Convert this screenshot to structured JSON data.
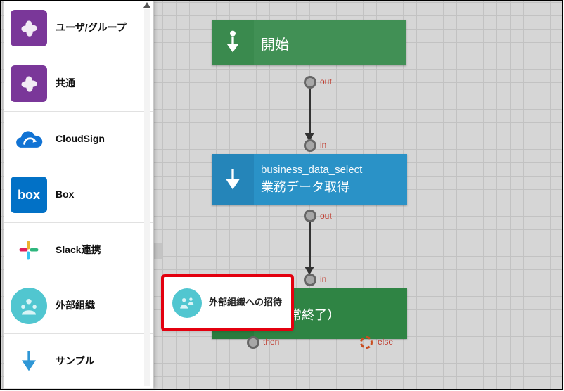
{
  "sidebar": {
    "items": [
      {
        "label": "ユーザ/グループ",
        "icon": "acrobat-icon"
      },
      {
        "label": "共通",
        "icon": "acrobat-icon"
      },
      {
        "label": "CloudSign",
        "icon": "cloudsign-icon"
      },
      {
        "label": "Box",
        "icon": "box-icon",
        "iconText": "box"
      },
      {
        "label": "Slack連携",
        "icon": "slack-icon"
      },
      {
        "label": "外部組織",
        "icon": "extorg-icon"
      },
      {
        "label": "サンプル",
        "icon": "sample-icon"
      }
    ]
  },
  "flow": {
    "start": {
      "title": "開始"
    },
    "biz": {
      "subtitle": "business_data_select",
      "title": "業務データ取得"
    },
    "end": {
      "title": "（正常終了）"
    },
    "ports": {
      "start_out": "out",
      "biz_in": "in",
      "biz_out": "out",
      "end_in": "in",
      "end_then": "then",
      "end_else": "else"
    }
  },
  "drop_card": {
    "label": "外部組織への招待"
  }
}
